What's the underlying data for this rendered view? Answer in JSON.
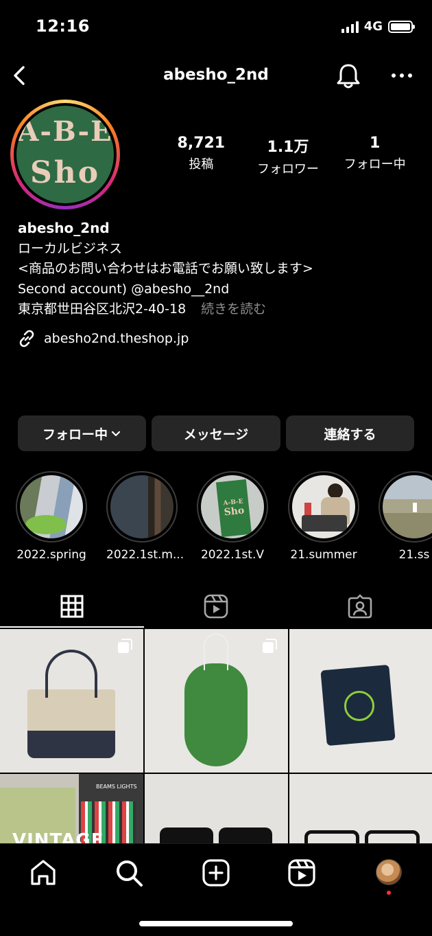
{
  "status_bar": {
    "time": "12:16",
    "network": "4G"
  },
  "header": {
    "username": "abesho_2nd"
  },
  "profile": {
    "avatar_text_top": "A-B-E",
    "avatar_text_bottom": "Sho",
    "stats": [
      {
        "value": "8,721",
        "label": "投稿"
      },
      {
        "value": "1.1万",
        "label": "フォロワー"
      },
      {
        "value": "1",
        "label": "フォロー中"
      }
    ],
    "name": "abesho_2nd",
    "category": "ローカルビジネス",
    "bio_line1": "<商品のお問い合わせはお電話でお願い致します>",
    "bio_line2": "Second account) @abesho__2nd",
    "address": "東京都世田谷区北沢2-40-18",
    "read_more": "続きを読む",
    "website": "abesho2nd.theshop.jp"
  },
  "actions": {
    "following": "フォロー中",
    "message": "メッセージ",
    "contact": "連絡する"
  },
  "highlights": [
    {
      "label": "2022.spring"
    },
    {
      "label": "2022.1st.m..."
    },
    {
      "label": "2022.1st.V"
    },
    {
      "label": "21.summer"
    },
    {
      "label": "21.ss"
    }
  ],
  "highlight_art": {
    "book_top": "A-B-E",
    "book_bottom": "Sho"
  },
  "grid_posts": {
    "post4_sign": "BEAMS LIGHTS",
    "post4_caption": "VINTAGE"
  },
  "colors": {
    "background": "#000000",
    "button": "#262626",
    "muted": "#8e8e8e",
    "notification_dot": "#ff3040"
  }
}
